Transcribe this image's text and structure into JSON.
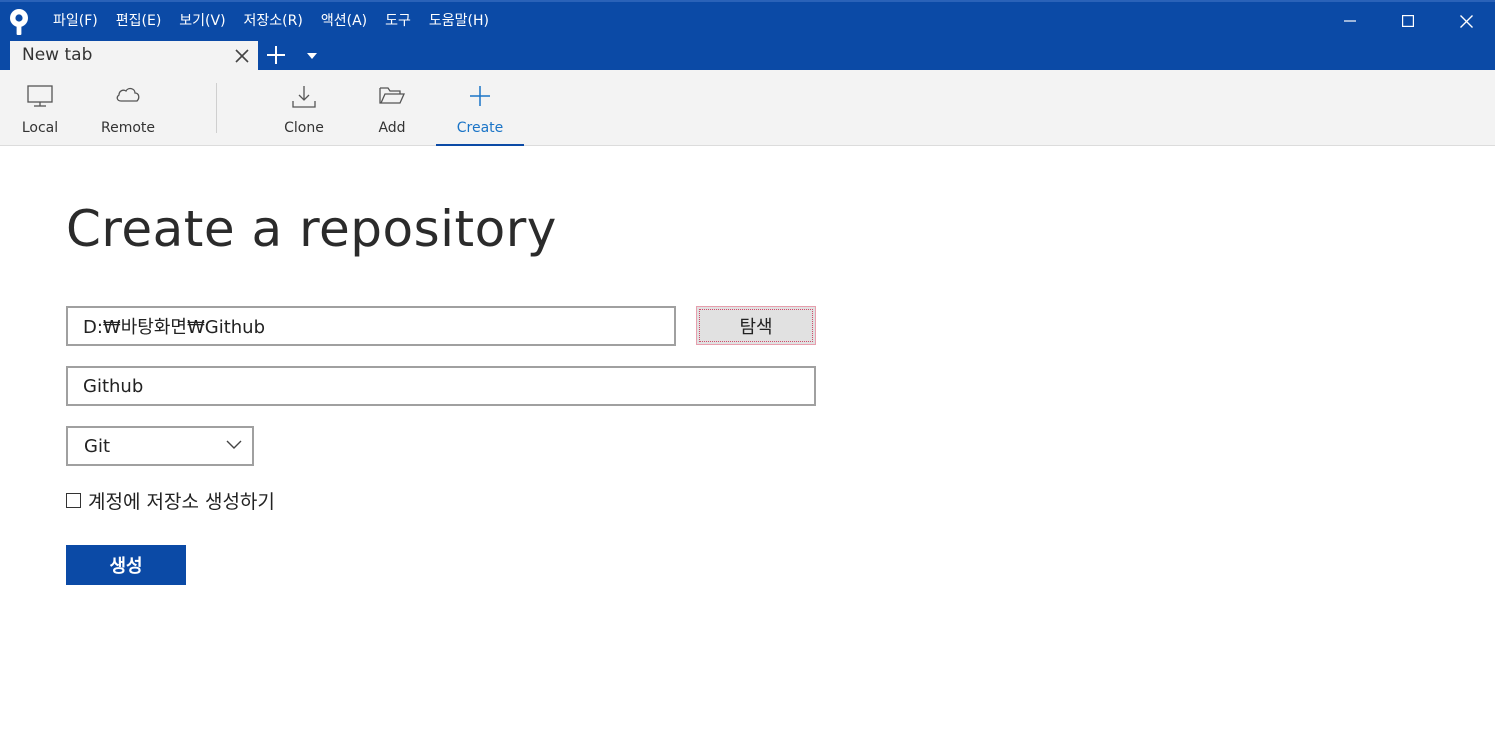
{
  "app": {
    "logo_icon": "sourcetree-logo-icon",
    "menu": [
      {
        "label": "파일(F)"
      },
      {
        "label": "편집(E)"
      },
      {
        "label": "보기(V)"
      },
      {
        "label": "저장소(R)"
      },
      {
        "label": "액션(A)"
      },
      {
        "label": "도구"
      },
      {
        "label": "도움말(H)"
      }
    ],
    "window_controls": [
      "minimize-icon",
      "maximize-icon",
      "close-icon"
    ]
  },
  "tabs": {
    "items": [
      {
        "label": "New tab"
      }
    ],
    "add_icon": "plus-icon",
    "menu_icon": "caret-down-icon"
  },
  "toolbar": {
    "items": [
      {
        "label": "Local",
        "icon": "monitor-icon",
        "active": false
      },
      {
        "label": "Remote",
        "icon": "cloud-icon",
        "active": false
      },
      {
        "label": "Clone",
        "icon": "download-icon",
        "active": false
      },
      {
        "label": "Add",
        "icon": "folder-open-icon",
        "active": false
      },
      {
        "label": "Create",
        "icon": "plus-icon",
        "active": true
      }
    ]
  },
  "form": {
    "title": "Create a repository",
    "path_value": "D:₩바탕화면₩Github",
    "browse_label": "탐색",
    "name_value": "Github",
    "vcs_selected": "Git",
    "account_checkbox_label": "계정에 저장소 생성하기",
    "account_checkbox_checked": false,
    "create_label": "생성"
  },
  "colors": {
    "accent": "#0b4aa6",
    "active_tool_text": "#1a74c7",
    "toolbar_bg": "#f3f3f3"
  }
}
